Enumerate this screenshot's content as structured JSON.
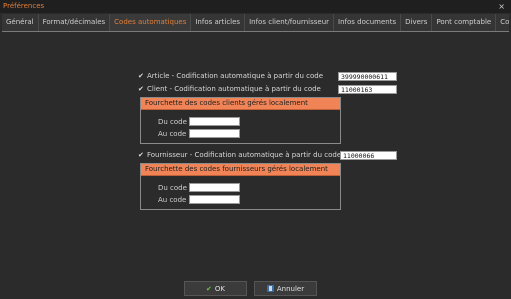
{
  "window": {
    "title": "Préférences",
    "close_glyph": "×"
  },
  "tabs": [
    {
      "label": "Général"
    },
    {
      "label": "Format/décimales"
    },
    {
      "label": "Codes automatiques"
    },
    {
      "label": "Infos articles"
    },
    {
      "label": "Infos client/fournisseur"
    },
    {
      "label": "Infos documents"
    },
    {
      "label": "Divers"
    },
    {
      "label": "Pont comptable"
    },
    {
      "label": "Cod"
    }
  ],
  "article": {
    "checked": true,
    "label": "Article - Codification automatique à partir du code",
    "value": "399990000611"
  },
  "client": {
    "checked": true,
    "label": "Client - Codification automatique à partir du code",
    "value": "11000163"
  },
  "client_range": {
    "header": "Fourchette des codes clients gérés localement",
    "from_label": "Du code",
    "to_label": "Au code",
    "from_value": "",
    "to_value": ""
  },
  "fournisseur": {
    "checked": true,
    "label": "Fournisseur - Codification automatique à partir du code",
    "value": "11000066"
  },
  "fournisseur_range": {
    "header": "Fourchette des codes fournisseurs gérés localement",
    "from_label": "Du code",
    "to_label": "Au code",
    "from_value": "",
    "to_value": ""
  },
  "footer": {
    "ok_label": "OK",
    "cancel_label": "Annuler"
  },
  "colors": {
    "accent": "#e07f3a",
    "group_header": "#f08456",
    "background": "#2b2b2b"
  }
}
